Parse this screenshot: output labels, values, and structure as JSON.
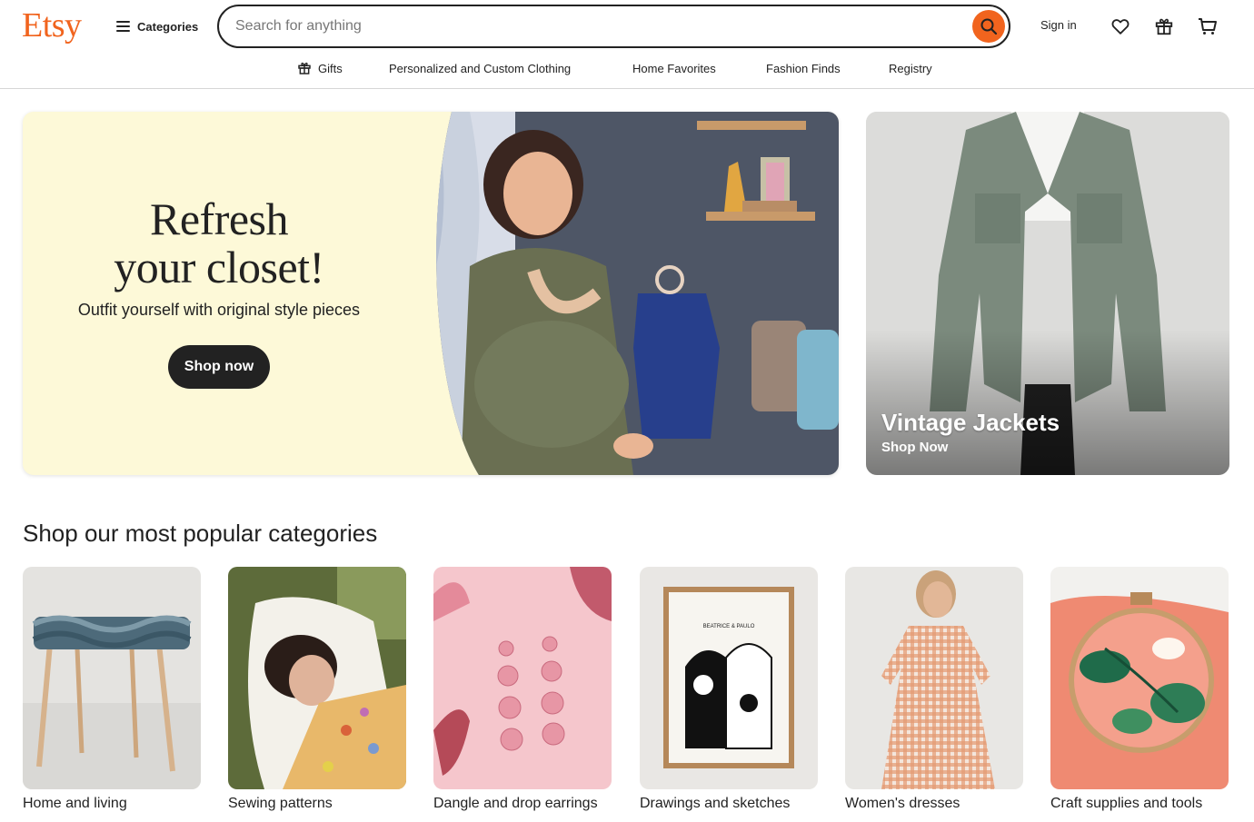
{
  "header": {
    "logo": "Etsy",
    "categories_label": "Categories",
    "search_placeholder": "Search for anything",
    "signin_label": "Sign in"
  },
  "nav": {
    "items": [
      {
        "label": "Gifts",
        "icon": "gift-icon"
      },
      {
        "label": "Personalized and Custom Clothing"
      },
      {
        "label": "Home Favorites"
      },
      {
        "label": "Fashion Finds"
      },
      {
        "label": "Registry"
      }
    ]
  },
  "hero": {
    "title_line1": "Refresh",
    "title_line2": "your closet!",
    "subtitle": "Outfit yourself with original style pieces",
    "cta": "Shop now"
  },
  "side_promo": {
    "title": "Vintage Jackets",
    "cta": "Shop Now"
  },
  "popular": {
    "title": "Shop our most popular categories",
    "items": [
      {
        "label": "Home and living"
      },
      {
        "label": "Sewing patterns"
      },
      {
        "label": "Dangle and drop earrings"
      },
      {
        "label": "Drawings and sketches",
        "print_text": "BEATRICE & PAULO"
      },
      {
        "label": "Women's dresses"
      },
      {
        "label": "Craft supplies and tools"
      }
    ]
  },
  "colors": {
    "brand_orange": "#f1641e",
    "hero_bg": "#fdf9d8",
    "dark": "#222222"
  }
}
